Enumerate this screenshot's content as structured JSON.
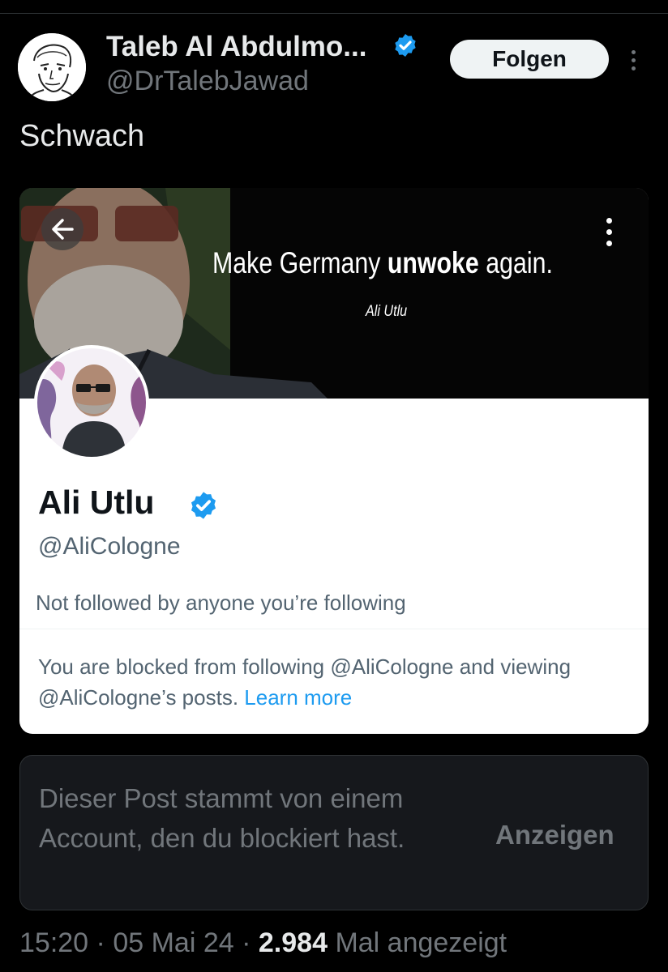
{
  "post": {
    "author_name": "Taleb Al Abdulmo...",
    "author_handle": "@DrTalebJawad",
    "follow_label": "Folgen",
    "text": "Schwach",
    "timestamp_time": "15:20",
    "separator": "·",
    "timestamp_date": "05 Mai 24",
    "view_count": "2.984",
    "view_suffix": "Mal angezeigt"
  },
  "embedded_profile": {
    "banner_slogan_pre": "Make Germany",
    "banner_slogan_bold": "unwoke",
    "banner_slogan_post": "again.",
    "banner_signature": "Ali Utlu",
    "name": "Ali Utlu",
    "handle": "@AliCologne",
    "followed_note": "Not followed by anyone you’re following",
    "blocked_note": "You are blocked from following @AliCologne and viewing @AliCologne’s posts.",
    "learn_more": "Learn more"
  },
  "blocked_notice": {
    "text": "Dieser Post stammt von einem Account, den du blockiert hast.",
    "show_label": "Anzeigen"
  },
  "icons": {
    "verified": "verified-badge-icon",
    "more": "more-vertical-icon",
    "back": "arrow-left-icon"
  },
  "colors": {
    "background": "#000000",
    "verified_blue": "#1d9bf0",
    "muted_text": "#71767b",
    "link": "#1d9bf0"
  }
}
